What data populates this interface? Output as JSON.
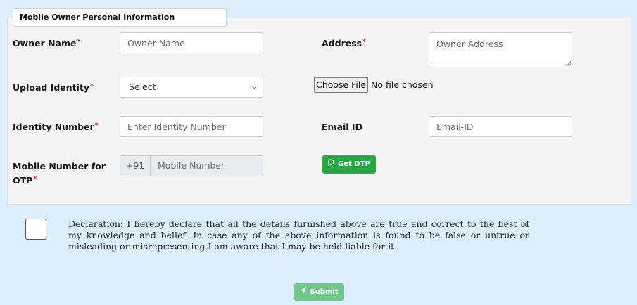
{
  "section": {
    "title": "Mobile Owner Personal Information"
  },
  "owner_name": {
    "label": "Owner Name",
    "placeholder": "Owner Name",
    "value": ""
  },
  "address": {
    "label": "Address",
    "placeholder": "Owner Address",
    "value": ""
  },
  "upload_identity": {
    "label": "Upload Identity",
    "selected": "Select"
  },
  "file": {
    "button_label": "Choose File",
    "status": "No file chosen"
  },
  "identity_number": {
    "label": "Identity Number",
    "placeholder": "Enter Identity Number",
    "value": ""
  },
  "email": {
    "label": "Email ID",
    "placeholder": "Email-ID",
    "value": ""
  },
  "mobile": {
    "label": "Mobile Number for OTP",
    "prefix": "+91",
    "placeholder": "Mobile Number"
  },
  "otp_button": {
    "label": "Get OTP",
    "icon": "chat-icon"
  },
  "declaration": {
    "checked": false,
    "text": "Declaration: I hereby declare that all the details furnished above are true and correct to the best of my knowledge and belief. In case any of the above information is found to be false or untrue or misleading or misrepresenting,I am aware that I may be held liable for it."
  },
  "submit_button": {
    "label": "Submit",
    "icon": "send-icon"
  },
  "colors": {
    "background": "#dcedfc",
    "panel": "#f4f4f4",
    "primary_green": "#28a745",
    "required": "#dd2222"
  },
  "required_marker": "*"
}
